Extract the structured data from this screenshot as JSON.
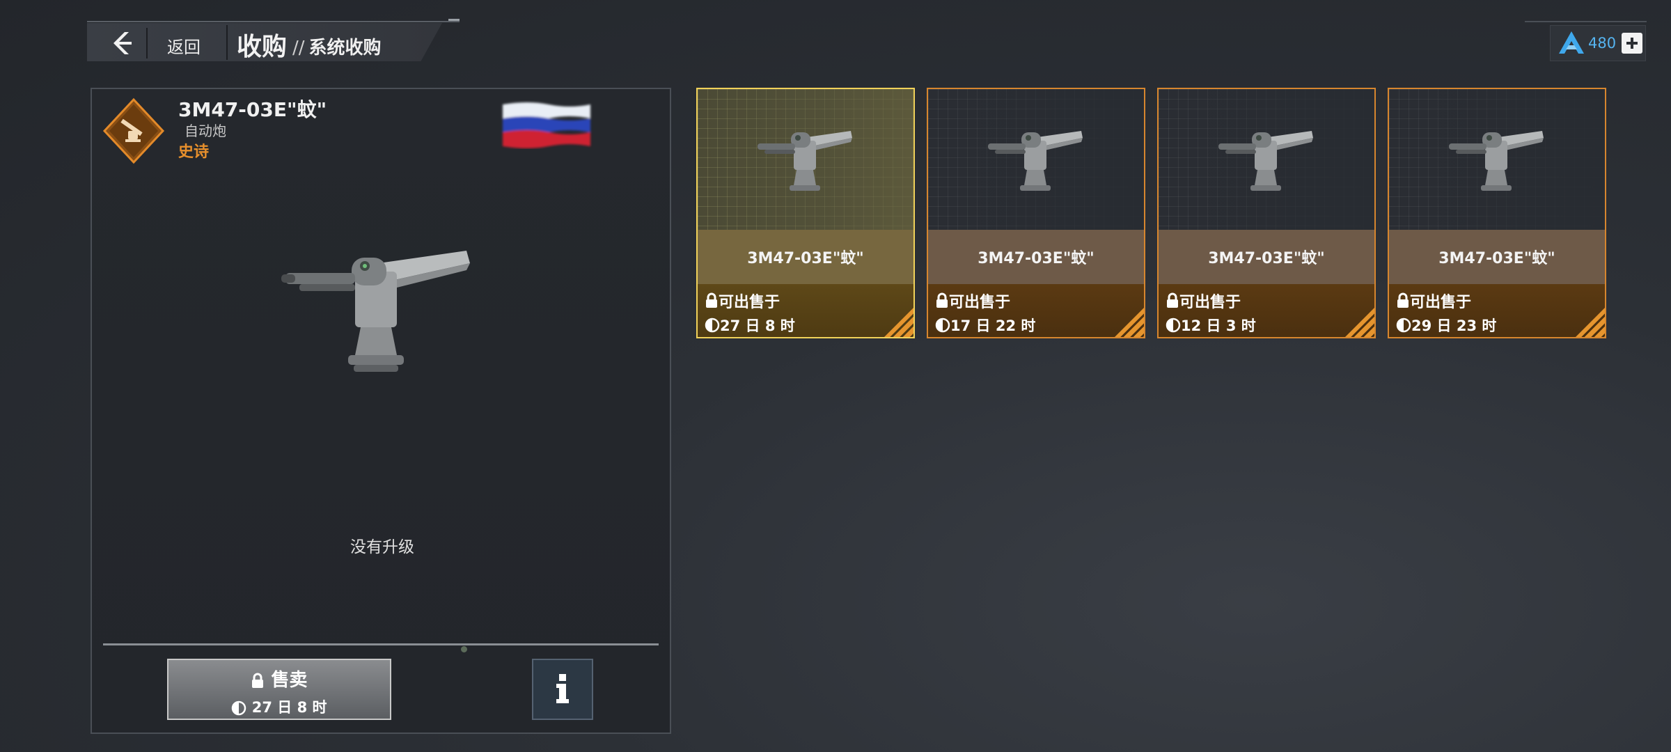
{
  "header": {
    "back_label": "返回",
    "title": "收购",
    "subtitle": "系统收购",
    "separator": "//"
  },
  "currency": {
    "icon": "alliance-a-icon",
    "value": "480",
    "plus_icon": "plus-icon",
    "color": "#55b4f0"
  },
  "detail": {
    "name": "3M47-03E\"蚊\"",
    "type": "自动炮",
    "rarity": "史诗",
    "rarity_color": "#e8902c",
    "nation_flag": "russia-flag",
    "upgrade_status": "没有升级",
    "sell": {
      "label": "售卖",
      "timer": "27 日 8 时"
    },
    "info_icon": "info-icon"
  },
  "cards": [
    {
      "name": "3M47-03E\"蚊\"",
      "status": "可出售于",
      "timer": "27 日 8 时",
      "selected": true
    },
    {
      "name": "3M47-03E\"蚊\"",
      "status": "可出售于",
      "timer": "17 日 22 时",
      "selected": false
    },
    {
      "name": "3M47-03E\"蚊\"",
      "status": "可出售于",
      "timer": "12 日 3 时",
      "selected": false
    },
    {
      "name": "3M47-03E\"蚊\"",
      "status": "可出售于",
      "timer": "29 日 23 时",
      "selected": false
    }
  ]
}
